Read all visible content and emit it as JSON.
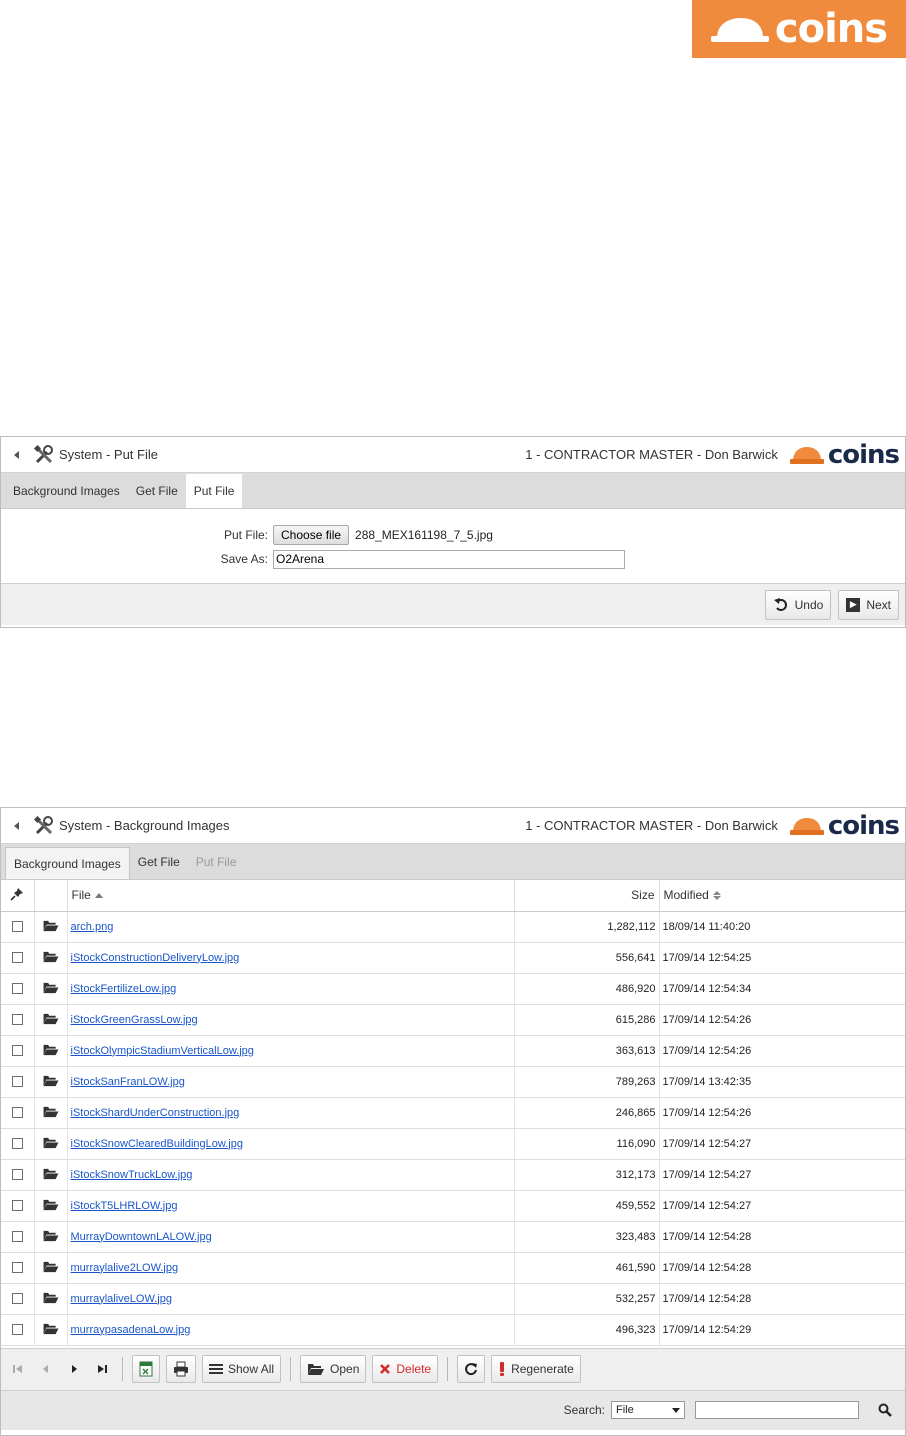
{
  "brand": {
    "logo_text": "coins",
    "color": "#f08a3c",
    "navy": "#1a2a4a"
  },
  "put_file_window": {
    "title": "System - Put File",
    "company": "1 - CONTRACTOR MASTER - Don Barwick",
    "tabs": [
      {
        "label": "Background Images"
      },
      {
        "label": "Get File"
      },
      {
        "label": "Put File"
      }
    ],
    "form": {
      "put_file_label": "Put File:",
      "choose_label": "Choose file",
      "chosen_file": "288_MEX161198_7_5.jpg",
      "save_as_label": "Save As:",
      "save_as_value": "O2Arena"
    },
    "buttons": {
      "undo": "Undo",
      "next": "Next"
    }
  },
  "bg_images_window": {
    "title": "System - Background Images",
    "company": "1 - CONTRACTOR MASTER - Don Barwick",
    "tabs": [
      {
        "label": "Background Images"
      },
      {
        "label": "Get File"
      },
      {
        "label": "Put File"
      }
    ],
    "columns": {
      "file": "File",
      "size": "Size",
      "modified": "Modified"
    },
    "rows": [
      {
        "file": "arch.png",
        "size": "1,282,112",
        "modified": "18/09/14 11:40:20"
      },
      {
        "file": "iStockConstructionDeliveryLow.jpg",
        "size": "556,641",
        "modified": "17/09/14 12:54:25"
      },
      {
        "file": "iStockFertilizeLow.jpg",
        "size": "486,920",
        "modified": "17/09/14 12:54:34"
      },
      {
        "file": "iStockGreenGrassLow.jpg",
        "size": "615,286",
        "modified": "17/09/14 12:54:26"
      },
      {
        "file": "iStockOlympicStadiumVerticalLow.jpg",
        "size": "363,613",
        "modified": "17/09/14 12:54:26"
      },
      {
        "file": "iStockSanFranLOW.jpg",
        "size": "789,263",
        "modified": "17/09/14 13:42:35"
      },
      {
        "file": "iStockShardUnderConstruction.jpg",
        "size": "246,865",
        "modified": "17/09/14 12:54:26"
      },
      {
        "file": "iStockSnowClearedBuildingLow.jpg",
        "size": "116,090",
        "modified": "17/09/14 12:54:27"
      },
      {
        "file": "iStockSnowTruckLow.jpg",
        "size": "312,173",
        "modified": "17/09/14 12:54:27"
      },
      {
        "file": "iStockT5LHRLOW.jpg",
        "size": "459,552",
        "modified": "17/09/14 12:54:27"
      },
      {
        "file": "MurrayDowntownLALOW.jpg",
        "size": "323,483",
        "modified": "17/09/14 12:54:28"
      },
      {
        "file": "murraylalive2LOW.jpg",
        "size": "461,590",
        "modified": "17/09/14 12:54:28"
      },
      {
        "file": "murraylaliveLOW.jpg",
        "size": "532,257",
        "modified": "17/09/14 12:54:28"
      },
      {
        "file": "murraypasadenaLow.jpg",
        "size": "496,323",
        "modified": "17/09/14 12:54:29"
      }
    ],
    "toolbar": {
      "show_all": "Show All",
      "open": "Open",
      "delete": "Delete",
      "regenerate": "Regenerate"
    },
    "search": {
      "label": "Search:",
      "field": "File"
    }
  }
}
